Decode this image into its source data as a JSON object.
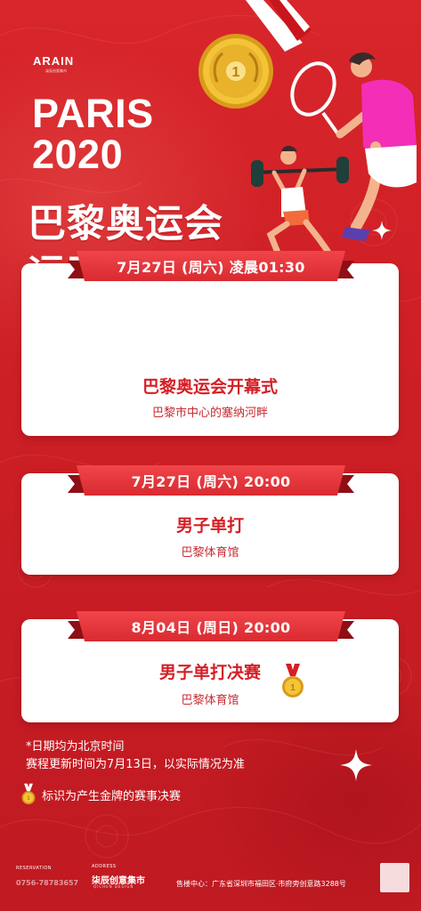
{
  "brand": {
    "name": "ARAIN",
    "sub": "柒辰创意集市"
  },
  "header": {
    "line1": "PARIS",
    "line2": "2020"
  },
  "title": {
    "line1": "巴黎奥运会",
    "line2": "运动比赛日程表"
  },
  "events": [
    {
      "time": "7月27日 (周六) 凌晨01:30",
      "name": "巴黎奥运会开幕式",
      "venue": "巴黎市中心的塞纳河畔"
    },
    {
      "time": "7月27日 (周六) 20:00",
      "name": "男子单打",
      "venue": "巴黎体育馆"
    },
    {
      "time": "8月04日 (周日) 20:00",
      "name": "男子单打决赛",
      "venue": "巴黎体育馆"
    }
  ],
  "notes": {
    "line1": "*日期均为北京时间",
    "line2": "赛程更新时间为7月13日，以实际情况为准",
    "legend": "标识为产生金牌的赛事决赛"
  },
  "footer": {
    "reservation_label": "RESERVATION",
    "phone": "0756-78783657",
    "address_label": "ADDRESS",
    "address_brand": "柒辰创意集市",
    "address_sub": "QICHEN DESIGN",
    "sales": "售楼中心：广东省深圳市福田区·市府旁创意路3288号"
  },
  "icons": {
    "medal": "gold-medal-icon",
    "sparkle": "sparkle-icon",
    "tennis": "tennis-player-illustration",
    "weightlifter": "weightlifter-illustration"
  },
  "colors": {
    "background": "#cc1e25",
    "accent_red": "#d41f26",
    "ribbon": "#e23a40",
    "gold": "#f3c437",
    "card": "#ffffff"
  }
}
